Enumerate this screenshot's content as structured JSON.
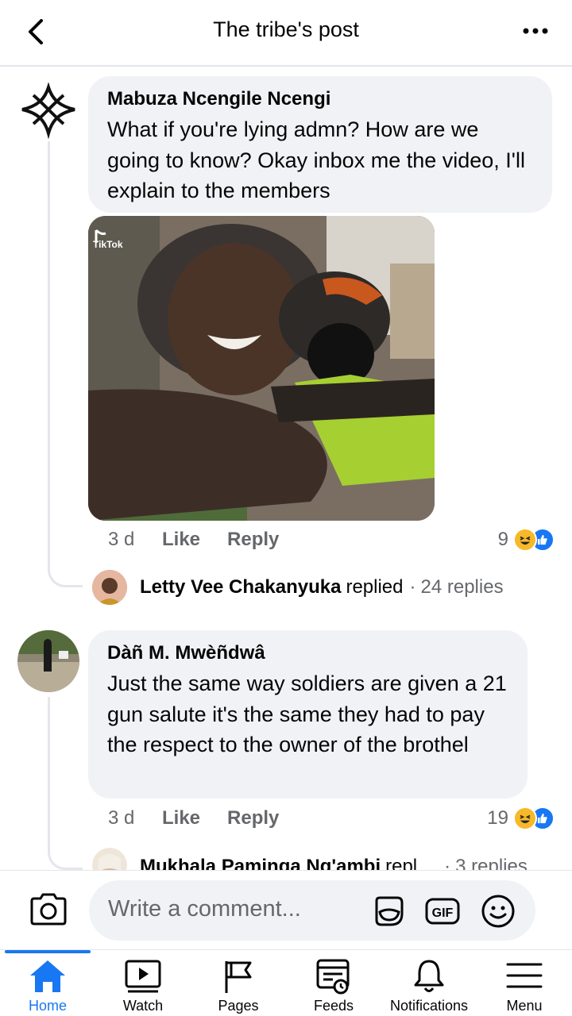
{
  "header": {
    "title": "The tribe's post"
  },
  "comments": [
    {
      "author": "Mabuza Ncengile Ncengi",
      "text": "What if you're lying admn? How are we going to know? Okay inbox me the video, I'll explain to the members",
      "media_watermark": "TikTok",
      "time": "3 d",
      "like_label": "Like",
      "reply_label": "Reply",
      "reaction_count": "9",
      "reactions": [
        "haha",
        "like"
      ],
      "reply_summary": {
        "name": "Letty Vee Chakanyuka",
        "verb": "replied",
        "count": "24 replies"
      }
    },
    {
      "author": "Dàñ M. Mwèñdwâ",
      "text": "Just the same way soldiers are given a 21 gun salute it's the same they had to pay the respect to the owner of the brothel",
      "time": "3 d",
      "like_label": "Like",
      "reply_label": "Reply",
      "reaction_count": "19",
      "reactions": [
        "haha",
        "like"
      ],
      "reply_summary": {
        "name": "Mukhala Paminga Ng'ambi",
        "verb": "repl",
        "count": "3 replies"
      }
    }
  ],
  "composer": {
    "placeholder": "Write a comment...",
    "gif_label": "GIF"
  },
  "tabs": [
    {
      "label": "Home",
      "icon": "home-icon",
      "active": true
    },
    {
      "label": "Watch",
      "icon": "watch-icon"
    },
    {
      "label": "Pages",
      "icon": "flag-icon"
    },
    {
      "label": "Feeds",
      "icon": "feeds-icon"
    },
    {
      "label": "Notifications",
      "icon": "bell-icon"
    },
    {
      "label": "Menu",
      "icon": "menu-icon"
    }
  ],
  "colors": {
    "accent": "#1877f2",
    "bubble": "#f0f2f5",
    "muted": "#65676b",
    "haha": "#f7b928"
  }
}
